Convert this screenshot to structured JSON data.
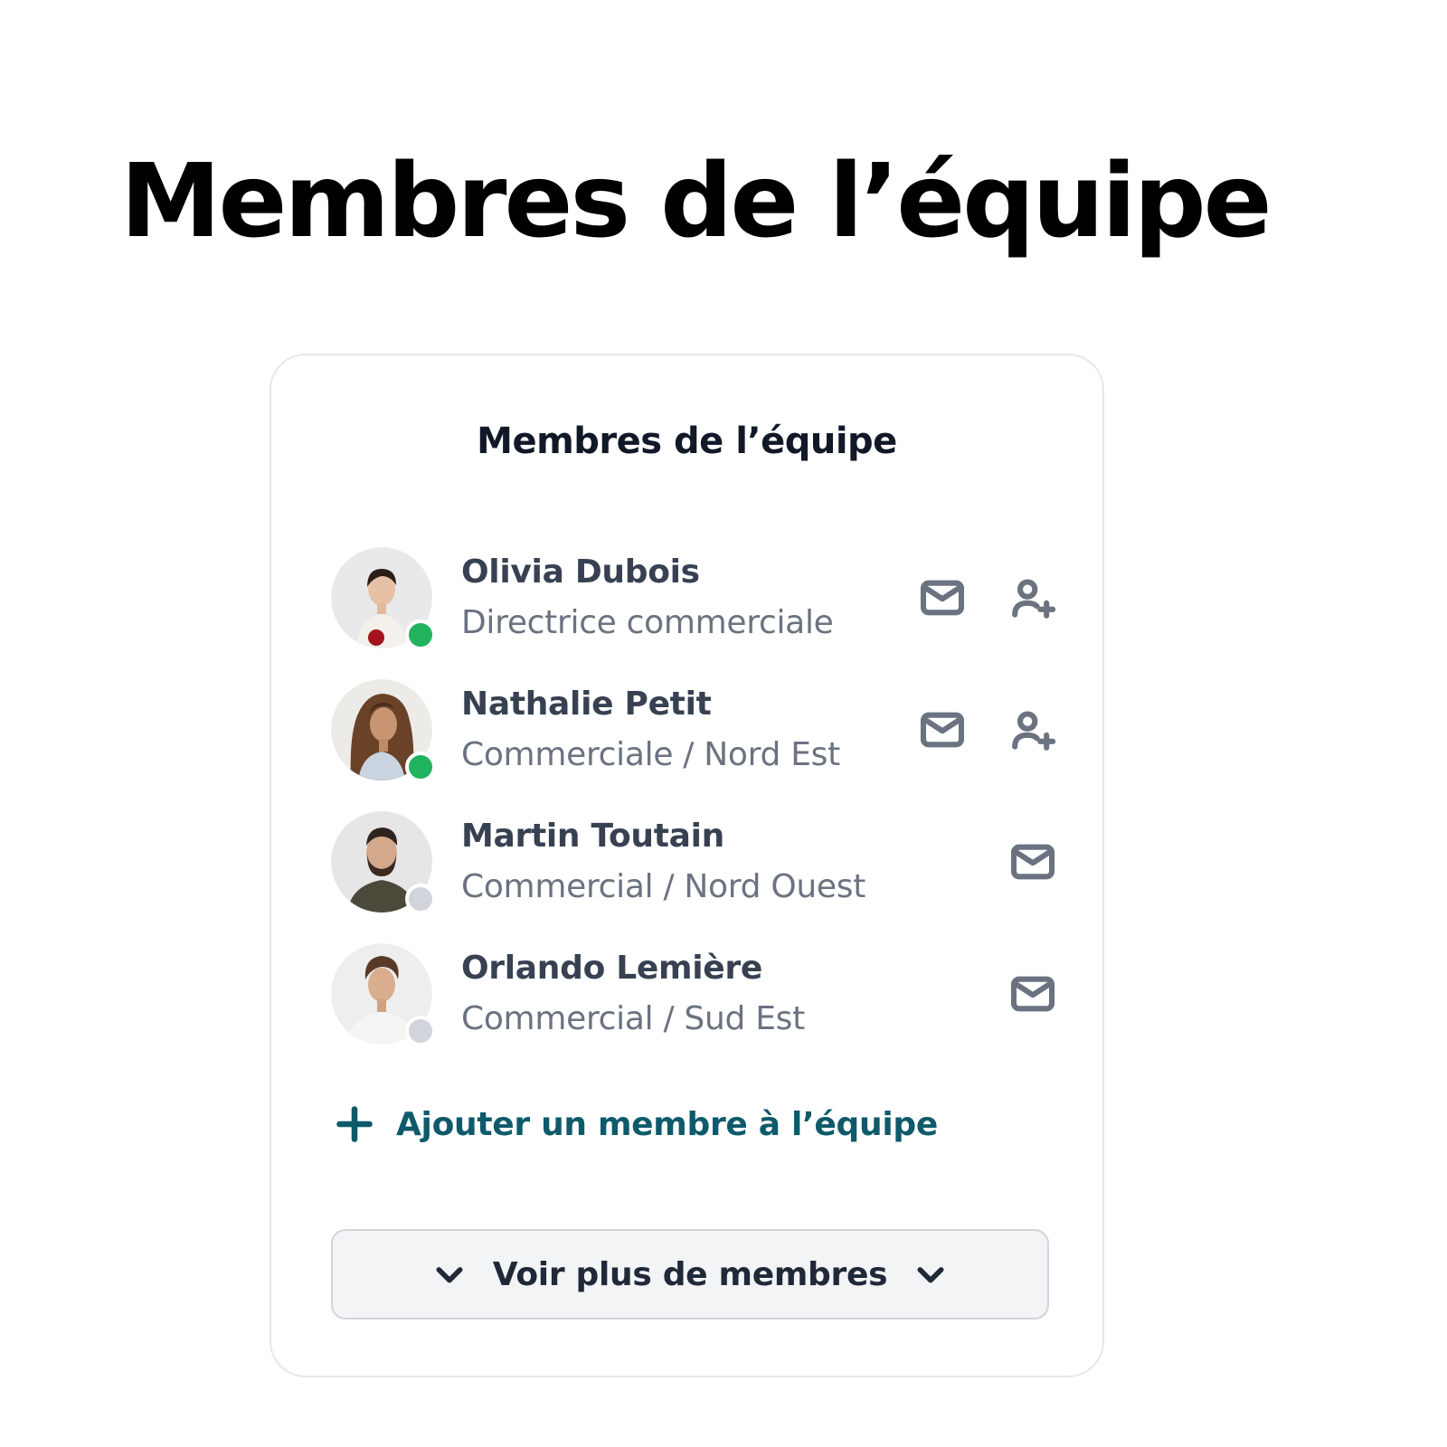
{
  "page": {
    "title": "Membres de l’équipe"
  },
  "card": {
    "title": "Membres de l’équipe",
    "members": [
      {
        "name": "Olivia Dubois",
        "role": "Directrice commerciale",
        "status": "online",
        "actions": [
          "mail-icon",
          "user-plus-icon"
        ]
      },
      {
        "name": "Nathalie Petit",
        "role": "Commerciale / Nord Est",
        "status": "online",
        "actions": [
          "mail-icon",
          "user-plus-icon"
        ]
      },
      {
        "name": "Martin Toutain",
        "role": "Commercial / Nord Ouest",
        "status": "offline",
        "actions": [
          "mail-icon"
        ]
      },
      {
        "name": "Orlando Lemière",
        "role": "Commercial / Sud Est",
        "status": "offline",
        "actions": [
          "mail-icon"
        ]
      }
    ],
    "add_member_label": "Ajouter un membre à l’équipe",
    "add_member_icon": "plus-icon",
    "more_button_label": "Voir plus de membres",
    "more_button_icon": "chevron-down-icon"
  },
  "colors": {
    "online": "#22b35e",
    "offline": "#d1d5db",
    "accent": "#0e5a6b",
    "icon": "#6b7280"
  }
}
